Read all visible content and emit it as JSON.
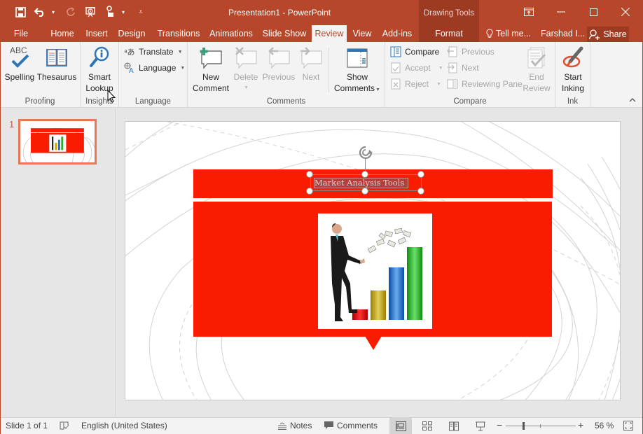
{
  "window": {
    "title": "Presentation1 - PowerPoint",
    "context_header": "Drawing Tools",
    "controls": [
      "ribbon-display-options",
      "minimize",
      "maximize",
      "close"
    ]
  },
  "qat": {
    "save": "save-icon",
    "undo": "undo-icon",
    "redo": "redo-icon",
    "present": "present-from-start-icon",
    "touch": "touch-mode-icon",
    "customize": "customize-qat-icon"
  },
  "tabs": [
    {
      "label": "File"
    },
    {
      "label": "Home"
    },
    {
      "label": "Insert"
    },
    {
      "label": "Design"
    },
    {
      "label": "Transitions"
    },
    {
      "label": "Animations"
    },
    {
      "label": "Slide Show"
    },
    {
      "label": "Review",
      "active": true
    },
    {
      "label": "View"
    },
    {
      "label": "Add-ins"
    },
    {
      "label": "Format"
    }
  ],
  "tell_me": "Tell me...",
  "user_name": "Farshad I...",
  "share_label": "Share",
  "ribbon": {
    "proofing": {
      "label": "Proofing",
      "spelling": "Spelling",
      "spelling_abc": "ABC",
      "thesaurus": "Thesaurus"
    },
    "insights": {
      "label": "Insights",
      "smart_lookup_1": "Smart",
      "smart_lookup_2": "Lookup"
    },
    "language": {
      "label": "Language",
      "translate": "Translate",
      "language": "Language"
    },
    "comments": {
      "label": "Comments",
      "new_1": "New",
      "new_2": "Comment",
      "delete": "Delete",
      "previous": "Previous",
      "next": "Next",
      "show_1": "Show",
      "show_2": "Comments"
    },
    "compare": {
      "label": "Compare",
      "compare": "Compare",
      "accept": "Accept",
      "reject": "Reject",
      "previous": "Previous",
      "next": "Next",
      "reviewing_pane": "Reviewing Pane",
      "end_1": "End",
      "end_2": "Review"
    },
    "ink": {
      "label": "Ink",
      "start_1": "Start",
      "start_2": "Inking"
    }
  },
  "thumbnails": [
    {
      "number": "1",
      "selected": true
    }
  ],
  "slide": {
    "title": "Market Analysis Tools",
    "accent_color": "#f91c00",
    "image": "businessman-climbing-bar-chart-with-money"
  },
  "status": {
    "slide_info": "Slide 1 of 1",
    "language": "English (United States)",
    "notes": "Notes",
    "comments": "Comments",
    "zoom": "56 %",
    "zoom_percent": 56
  },
  "colors": {
    "brand": "#b7472a",
    "brand_dark": "#9c3a22",
    "ribbon_bg": "#f3f3f3",
    "slide_red": "#f91c00"
  }
}
